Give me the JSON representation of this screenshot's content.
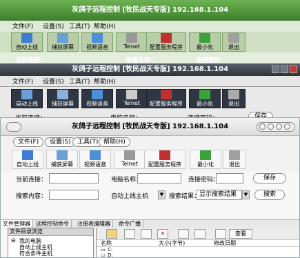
{
  "window_title": "灰鸽子远程控制 [牧民战天专版] 192.168.1.104",
  "menu": [
    "文件(F)",
    "设置(S)",
    "工具(T)",
    "帮助(H)"
  ],
  "toolbar": [
    "自动上线",
    "捕获屏幕",
    "视频语音",
    "Telnet",
    "配置服务程序",
    "最小化",
    "退出"
  ],
  "conn": {
    "current_label": "当前连接：",
    "computer_label": "电脑名称：",
    "password_label": "连接密码：",
    "save": "保存"
  },
  "search": {
    "content_label": "搜索内容：",
    "group_value": "自动上线主机",
    "result_label": "搜索结果：",
    "result_value": "显示搜索结果",
    "button": "搜索"
  },
  "tabs": [
    "文件管理器",
    "远程控制命令",
    "注册表编辑器",
    "命令广播"
  ],
  "left_panel": {
    "header": "文件目录浏览",
    "tree": [
      "我的电脑",
      "自动上线主机",
      "符合条件主机"
    ]
  },
  "right_panel": {
    "view_label": "查看",
    "columns": [
      "名称",
      "大小(字节)",
      "修改日期"
    ],
    "drives": [
      "C:",
      "D:",
      "E:",
      "F:"
    ]
  },
  "colors": {
    "green_skin": "#4f9a3b",
    "dark_skin": "#3a3f48",
    "light_skin": "#f2f2f2",
    "close_red": "#c0392b"
  }
}
